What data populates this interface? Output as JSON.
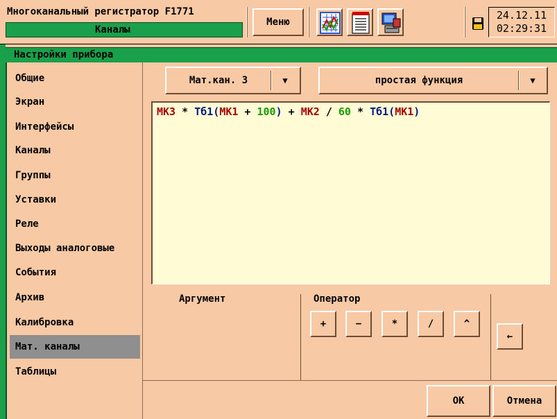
{
  "header": {
    "title": "Многоканальный регистратор F1771",
    "mode": "Каналы",
    "menu_label": "Меню",
    "icons": [
      "chart-icon",
      "document-icon",
      "computer-icon"
    ],
    "storage_icon": "floppy-disk-icon",
    "date": "24.12.11",
    "time": "02:29:31"
  },
  "panel": {
    "title": "Настройки прибора"
  },
  "sidebar": {
    "items": [
      {
        "label": "Общие"
      },
      {
        "label": "Экран"
      },
      {
        "label": "Интерфейсы"
      },
      {
        "label": "Каналы"
      },
      {
        "label": "Группы"
      },
      {
        "label": "Уставки"
      },
      {
        "label": "Реле"
      },
      {
        "label": "Выходы аналоговые"
      },
      {
        "label": "События"
      },
      {
        "label": "Архив"
      },
      {
        "label": "Калибровка"
      },
      {
        "label": "Мат. каналы"
      },
      {
        "label": "Таблицы"
      }
    ],
    "active_index": 11
  },
  "main": {
    "channel_select": "Мат.кан. 3",
    "function_select": "простая функция",
    "dropdown_arrow": "▼",
    "formula": [
      {
        "text": "МК3",
        "color": "red"
      },
      {
        "text": " * ",
        "color": "black"
      },
      {
        "text": "Тб1",
        "color": "blue"
      },
      {
        "text": "(",
        "color": "blue"
      },
      {
        "text": "МК1",
        "color": "red"
      },
      {
        "text": " + ",
        "color": "black"
      },
      {
        "text": "100",
        "color": "green"
      },
      {
        "text": ")",
        "color": "blue"
      },
      {
        "text": " + ",
        "color": "black"
      },
      {
        "text": "МК2",
        "color": "red"
      },
      {
        "text": " / ",
        "color": "black"
      },
      {
        "text": "60",
        "color": "green"
      },
      {
        "text": " * ",
        "color": "black"
      },
      {
        "text": "Тб1",
        "color": "blue"
      },
      {
        "text": "(",
        "color": "blue"
      },
      {
        "text": "МК1",
        "color": "red"
      },
      {
        "text": ")",
        "color": "blue"
      }
    ],
    "argument_label": "Аргумент",
    "operator_label": "Оператор",
    "operators": [
      "+",
      "−",
      "*",
      "/",
      "^"
    ],
    "backspace_label": "←",
    "ok_label": "ОК",
    "cancel_label": "Отмена"
  },
  "colors": {
    "background": "#f7c9a5",
    "accent_green": "#1aa04b",
    "active_item": "#8f8f8f",
    "formula_bg": "#fffbd4",
    "channel_red": "#a30000",
    "table_blue": "#001a80",
    "number_green": "#1a9c00"
  }
}
